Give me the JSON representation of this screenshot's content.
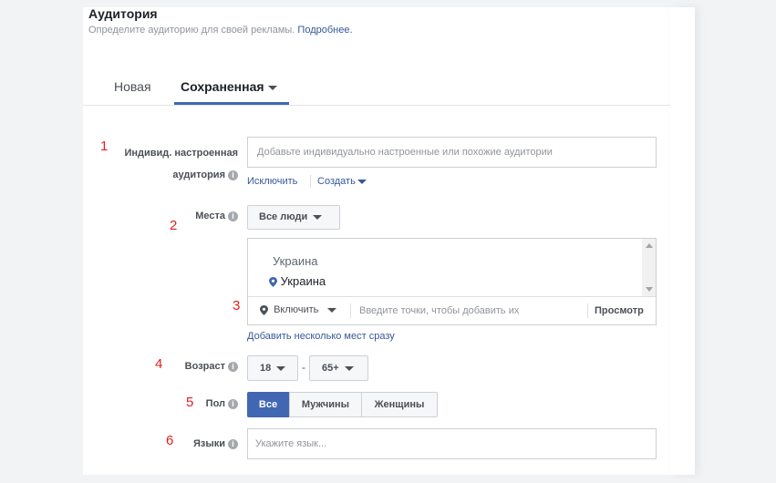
{
  "header": {
    "title": "Аудитория",
    "subtitle": "Определите аудиторию для своей рекламы.",
    "more_link": "Подробнее."
  },
  "tabs": [
    {
      "label": "Новая",
      "active": false
    },
    {
      "label": "Сохраненная",
      "active": true
    }
  ],
  "annotations": [
    "1",
    "2",
    "3",
    "4",
    "5",
    "6"
  ],
  "custom_audience": {
    "label_line1": "Индивид. настроенная",
    "label_line2": "аудитория",
    "placeholder": "Добавьте индивидуально настроенные или похожие аудитории",
    "exclude_link": "Исключить",
    "create_link": "Создать"
  },
  "locations": {
    "label": "Места",
    "people_dropdown": "Все люди",
    "group_header": "Украина",
    "selected_item": "Украина",
    "include_dropdown": "Включить",
    "search_placeholder": "Введите точки, чтобы добавить их",
    "browse_button": "Просмотр",
    "bulk_link": "Добавить несколько мест сразу"
  },
  "age": {
    "label": "Возраст",
    "min": "18",
    "separator": "-",
    "max": "65+"
  },
  "gender": {
    "label": "Пол",
    "options": [
      "Все",
      "Мужчины",
      "Женщины"
    ],
    "selected": "Все"
  },
  "languages": {
    "label": "Языки",
    "placeholder": "Укажите язык..."
  },
  "colors": {
    "accent": "#4267b2",
    "link": "#365899",
    "annotation": "#e02020"
  }
}
